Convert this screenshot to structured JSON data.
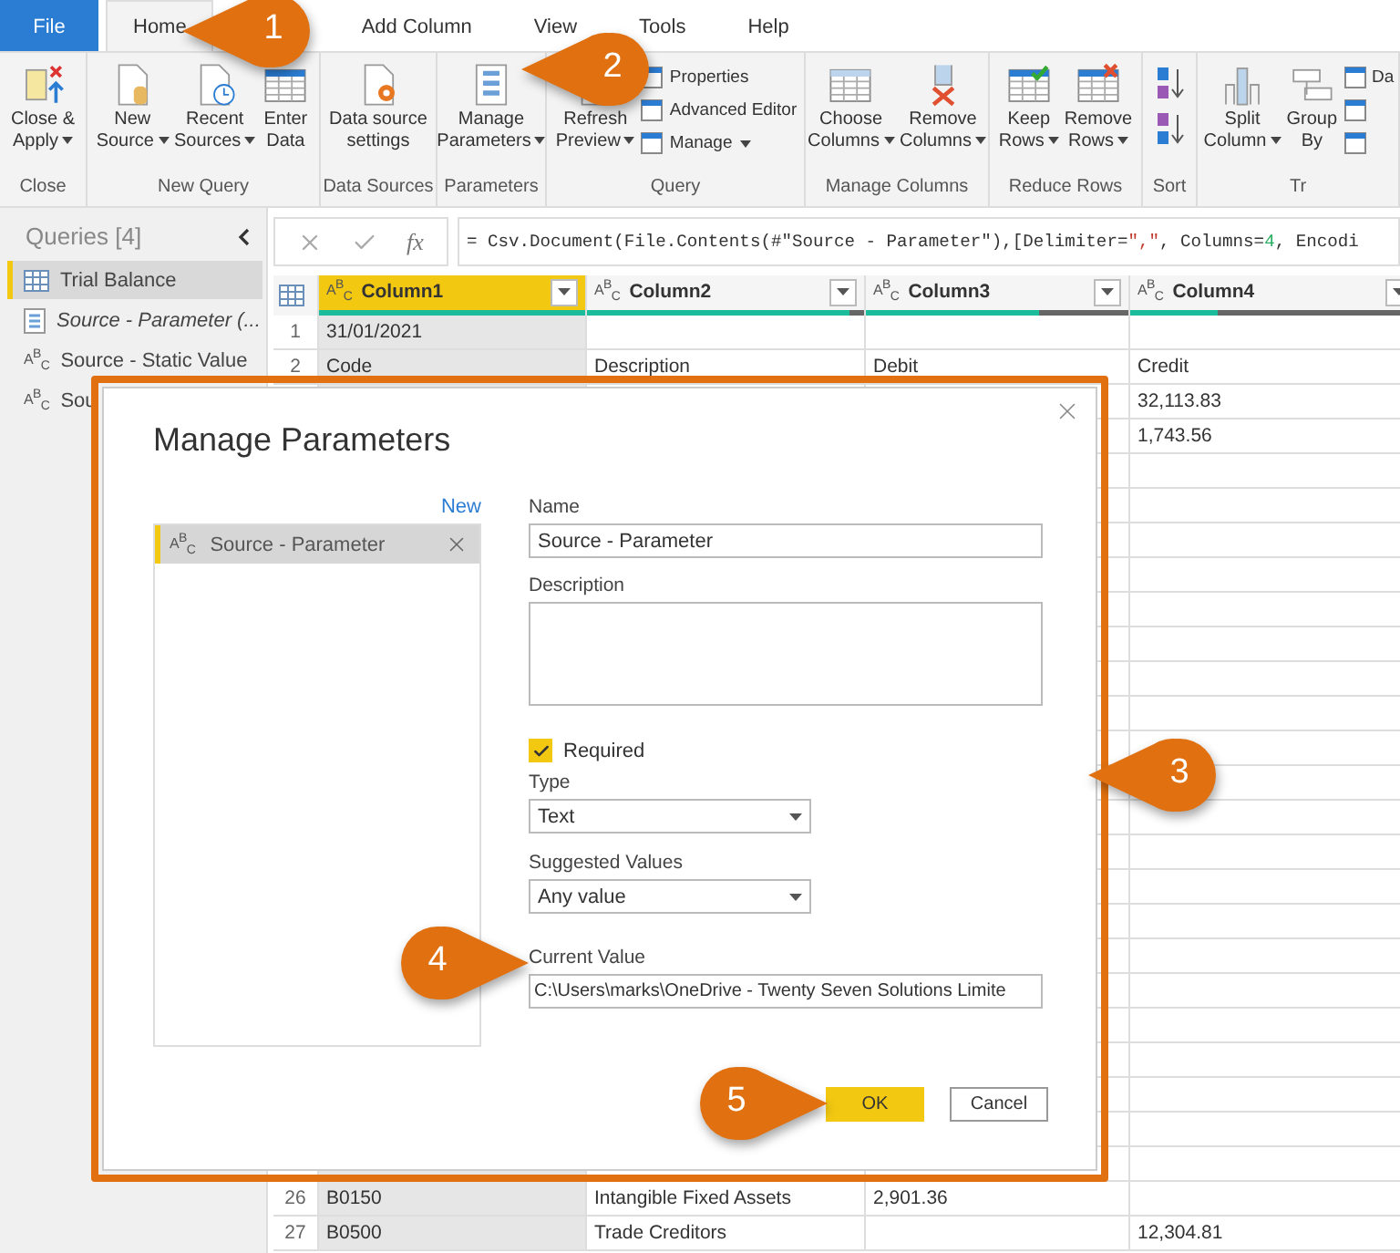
{
  "tabs": [
    {
      "label": "File",
      "kind": "file",
      "selected": false
    },
    {
      "label": "Home",
      "kind": "tab",
      "selected": true
    },
    {
      "label": "Add Column",
      "kind": "tab",
      "selected": false
    },
    {
      "label": "View",
      "kind": "tab",
      "selected": false
    },
    {
      "label": "Tools",
      "kind": "tab",
      "selected": false
    },
    {
      "label": "Help",
      "kind": "tab",
      "selected": false
    }
  ],
  "ribbon": {
    "groups": [
      {
        "label": "Close",
        "kind": "large",
        "buttons": [
          {
            "lines": [
              "Close &",
              "Apply"
            ],
            "dropdown": true
          }
        ]
      },
      {
        "label": "New Query",
        "kind": "large",
        "buttons": [
          {
            "lines": [
              "New",
              "Source"
            ],
            "dropdown": true
          },
          {
            "lines": [
              "Recent",
              "Sources"
            ],
            "dropdown": true
          },
          {
            "lines": [
              "Enter",
              "Data"
            ],
            "dropdown": false
          }
        ]
      },
      {
        "label": "Data Sources",
        "kind": "large",
        "buttons": [
          {
            "lines": [
              "Data source",
              "settings"
            ],
            "dropdown": false
          }
        ]
      },
      {
        "label": "Parameters",
        "kind": "large",
        "buttons": [
          {
            "lines": [
              "Manage",
              "Parameters"
            ],
            "dropdown": true
          }
        ]
      },
      {
        "label": "Query",
        "kind": "large",
        "buttons": [
          {
            "lines": [
              "Refresh",
              "Preview"
            ],
            "dropdown": true
          }
        ],
        "small_buttons": [
          {
            "label": "Properties",
            "dropdown": false
          },
          {
            "label": "Advanced Editor",
            "dropdown": false
          },
          {
            "label": "Manage",
            "dropdown": true
          }
        ]
      },
      {
        "label": "Manage Columns",
        "kind": "large",
        "buttons": [
          {
            "lines": [
              "Choose",
              "Columns"
            ],
            "dropdown": true
          },
          {
            "lines": [
              "Remove",
              "Columns"
            ],
            "dropdown": true
          }
        ]
      },
      {
        "label": "Reduce Rows",
        "kind": "large",
        "buttons": [
          {
            "lines": [
              "Keep",
              "Rows"
            ],
            "dropdown": true
          },
          {
            "lines": [
              "Remove",
              "Rows"
            ],
            "dropdown": true
          }
        ]
      },
      {
        "label": "Sort",
        "kind": "sort"
      },
      {
        "label": "Tr",
        "kind": "large",
        "buttons": [
          {
            "lines": [
              "Split",
              "Column"
            ],
            "dropdown": true
          },
          {
            "lines": [
              "Group",
              "By"
            ],
            "dropdown": false
          }
        ],
        "small_buttons": [
          {
            "label": "Da",
            "dropdown": false
          },
          {
            "dropdown": false
          },
          {
            "dropdown": false
          }
        ]
      }
    ]
  },
  "queries": {
    "title": "Queries [4]",
    "items": [
      {
        "kind": "table",
        "name": "Trial Balance",
        "selected": true
      },
      {
        "kind": "parameter",
        "name": "Source - Parameter (...",
        "selected": false
      },
      {
        "kind": "text",
        "type_label": "A$^{B}$$_{C}$",
        "name": "Source - Static Value",
        "selected": false
      },
      {
        "kind": "text",
        "type_label": "A$^{B}$$_{C}$",
        "name": "Sou",
        "selected": false
      }
    ]
  },
  "formula_bar": {
    "fx": "fx",
    "segments": [
      {
        "kind": "plain",
        "text": "= Csv.Document(File.Contents(#\"Source - Parameter\"),[Delimiter="
      },
      {
        "kind": "string",
        "text": "\",\""
      },
      {
        "kind": "plain",
        "text": ", Columns="
      },
      {
        "kind": "number",
        "text": "4"
      },
      {
        "kind": "plain",
        "text": ", Encodi"
      }
    ]
  },
  "grid": {
    "columns": [
      {
        "type_label": "A$^{B}$$_{C}$",
        "name": "Column1",
        "selected": true,
        "level": 1
      },
      {
        "type_label": "A$^{B}$$_{C}$",
        "name": "Column2",
        "selected": false,
        "level": 0.95
      },
      {
        "type_label": "A$^{B}$$_{C}$",
        "name": "Column3",
        "selected": false,
        "level": 0.66
      },
      {
        "type_label": "A$^{B}$$_{C}$",
        "name": "Column4",
        "selected": false,
        "level": 0.3
      }
    ],
    "rows_top": [
      {
        "number": "1",
        "column1": "31/01/2021"
      },
      {
        "number": "2",
        "column1": "Code",
        "column2": "Description",
        "column3": "Debit",
        "column4": "Credit"
      },
      {
        "column4": "32,113.83"
      },
      {
        "column4": "1,743.56"
      }
    ],
    "rows_bottom": [
      {
        "number": "26",
        "column1": "B0150",
        "column2": "Intangible Fixed Assets",
        "column3": "2,901.36"
      },
      {
        "number": "27",
        "column1": "B0500",
        "column2": "Trade Creditors",
        "column4": "12,304.81"
      }
    ]
  },
  "dialog": {
    "title": "Manage Parameters",
    "new_link": "New",
    "parameters": [
      {
        "type_label": "A$^{B}$$_{C}$",
        "name": "Source - Parameter",
        "selected": true
      }
    ],
    "name_label": "Name",
    "name_value": "Source - Parameter",
    "description_label": "Description",
    "required": {
      "label": "Required",
      "checked": true
    },
    "type_label": "Type",
    "type_value": "Text",
    "suggested_label": "Suggested Values",
    "suggested_value": "Any value",
    "current_label": "Current Value",
    "current_value": "C:\\Users\\marks\\OneDrive - Twenty Seven Solutions Limite",
    "buttons": [
      {
        "label": "OK",
        "primary": true
      },
      {
        "label": "Cancel",
        "primary": false
      }
    ]
  },
  "callouts": [
    {
      "number": "1"
    },
    {
      "number": "2"
    },
    {
      "number": "3"
    },
    {
      "number": "4"
    },
    {
      "number": "5"
    }
  ]
}
